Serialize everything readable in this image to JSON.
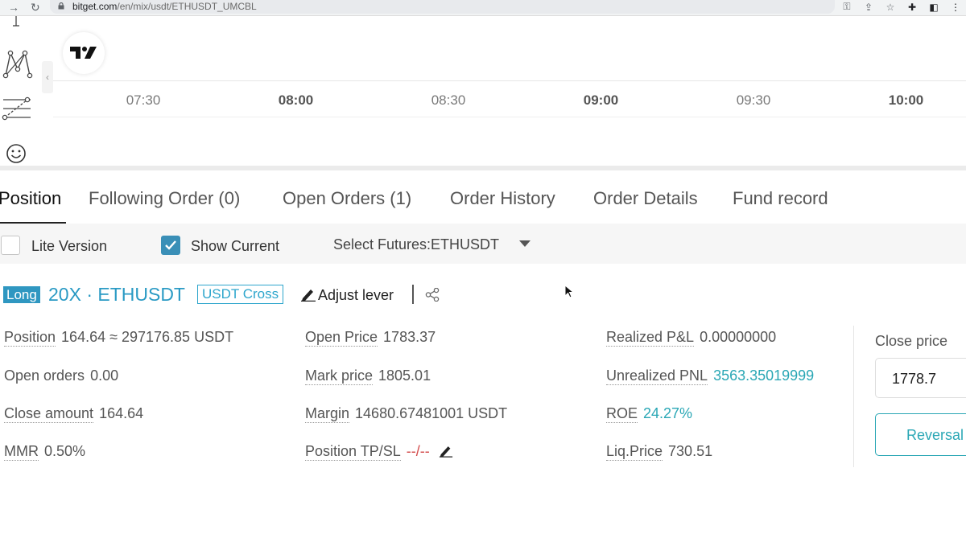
{
  "browser": {
    "url_domain": "bitget.com",
    "url_path": "/en/mix/usdt/ETHUSDT_UMCBL"
  },
  "chart": {
    "time_labels": [
      {
        "text": "07:30",
        "bold": false
      },
      {
        "text": "08:00",
        "bold": true
      },
      {
        "text": "08:30",
        "bold": false
      },
      {
        "text": "09:00",
        "bold": true
      },
      {
        "text": "09:30",
        "bold": false
      },
      {
        "text": "10:00",
        "bold": true
      }
    ]
  },
  "tabs": [
    {
      "label": "Position",
      "active": true
    },
    {
      "label": "Following Order (0)",
      "active": false
    },
    {
      "label": "Open Orders (1)",
      "active": false
    },
    {
      "label": "Order History",
      "active": false
    },
    {
      "label": "Order Details",
      "active": false
    },
    {
      "label": "Fund record",
      "active": false
    }
  ],
  "filters": {
    "lite_version": {
      "label": "Lite Version",
      "checked": false
    },
    "show_current": {
      "label": "Show Current",
      "checked": true
    },
    "futures_select": "Select Futures:ETHUSDT"
  },
  "position": {
    "side": "Long",
    "leverage_pair": "20X · ETHUSDT",
    "margin_mode": "USDT Cross",
    "adjust_lever": "Adjust lever",
    "fields": {
      "position": {
        "label": "Position",
        "value": "164.64 ≈ 297176.85 USDT"
      },
      "open_orders": {
        "label": "Open orders",
        "value": "0.00"
      },
      "close_amount": {
        "label": "Close amount",
        "value": "164.64"
      },
      "mmr": {
        "label": "MMR",
        "value": "0.50%"
      },
      "open_price": {
        "label": "Open Price",
        "value": "1783.37"
      },
      "mark_price": {
        "label": "Mark price",
        "value": "1805.01"
      },
      "margin": {
        "label": "Margin",
        "value": "14680.67481001 USDT"
      },
      "tp_sl": {
        "label": "Position TP/SL",
        "value": "--/--"
      },
      "realized_pnl": {
        "label": "Realized P&L",
        "value": "0.00000000"
      },
      "unrealized_pnl": {
        "label": "Unrealized PNL",
        "value": "3563.35019999"
      },
      "roe": {
        "label": "ROE",
        "value": "24.27%"
      },
      "liq_price": {
        "label": "Liq.Price",
        "value": "730.51"
      }
    }
  },
  "close_panel": {
    "label": "Close price",
    "value": "1778.7",
    "reversal": "Reversal"
  },
  "colors": {
    "accent": "#2aa7b5",
    "long_badge": "#2f97c1",
    "checkbox": "#3a8fb7"
  }
}
